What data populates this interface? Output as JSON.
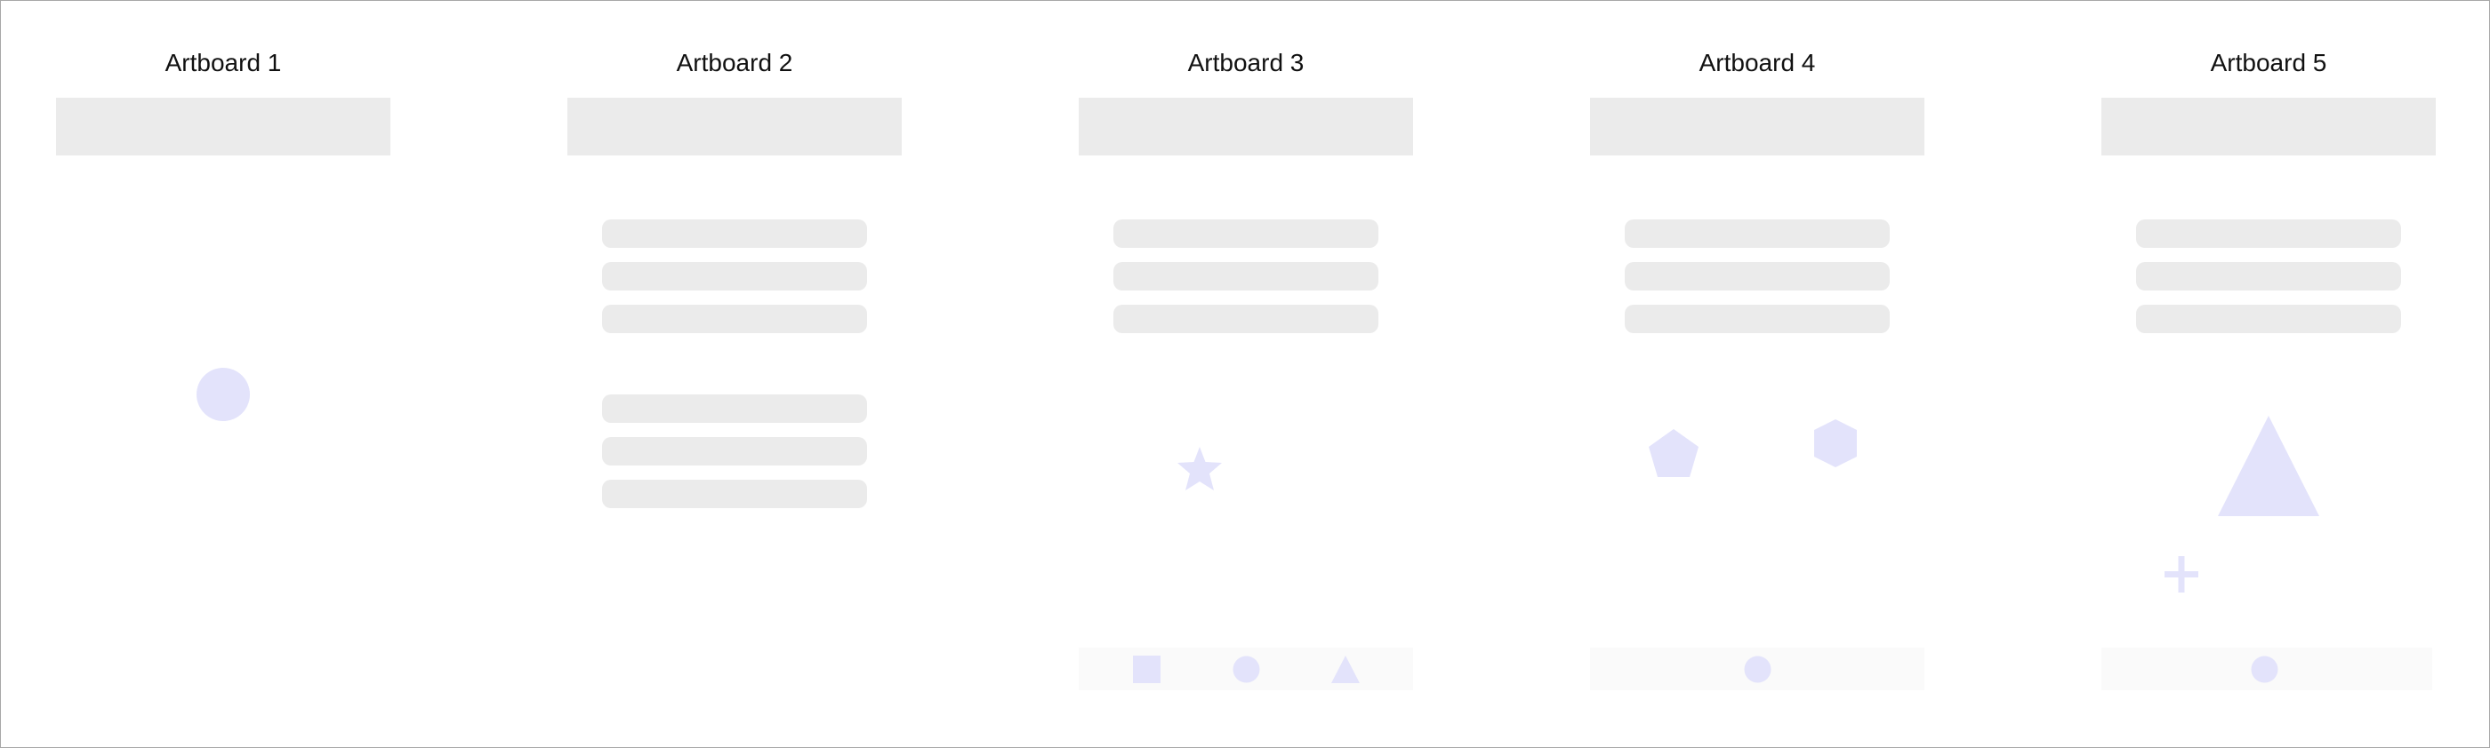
{
  "artboards": [
    {
      "title": "Artboard 1"
    },
    {
      "title": "Artboard 2"
    },
    {
      "title": "Artboard 3"
    },
    {
      "title": "Artboard 4"
    },
    {
      "title": "Artboard 5"
    }
  ],
  "colors": {
    "placeholder_gray": "#ebebeb",
    "shape_lavender": "#e3e3fb",
    "bottom_bar": "#fafafa",
    "frame_border": "#a8a8a8"
  },
  "icons": {
    "artboard_1": [
      "circle-icon"
    ],
    "artboard_3": [
      "star-icon",
      "square-icon",
      "circle-icon",
      "triangle-icon"
    ],
    "artboard_4": [
      "pentagon-icon",
      "hexagon-icon",
      "circle-icon"
    ],
    "artboard_5": [
      "triangle-icon",
      "plus-icon",
      "circle-icon"
    ]
  }
}
